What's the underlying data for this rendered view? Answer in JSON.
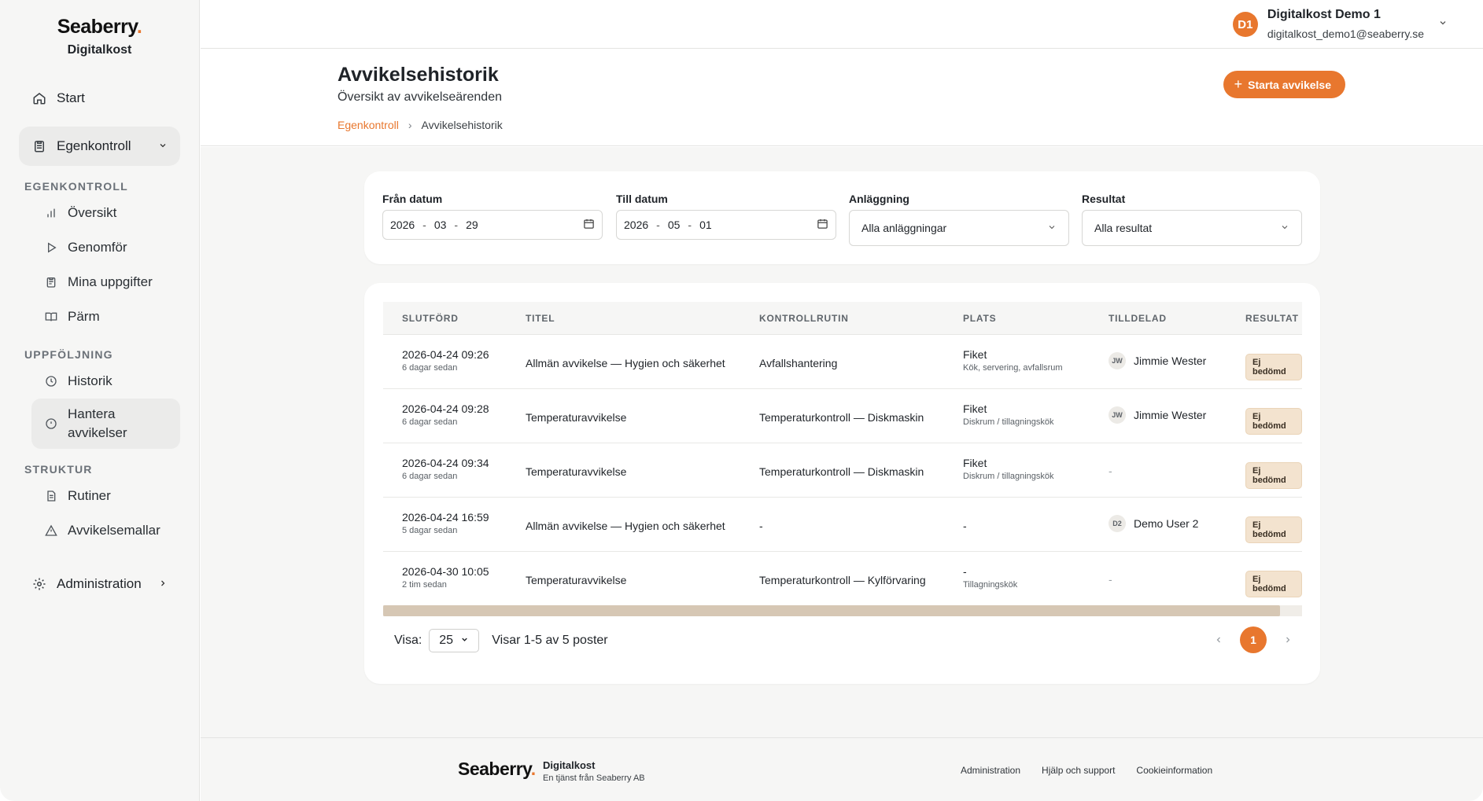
{
  "brand": {
    "logo": "Seaberry",
    "logo_dot": ".",
    "product": "Digitalkost"
  },
  "sidebar": {
    "start": "Start",
    "egenkontroll": "Egenkontroll",
    "sections": {
      "egenkontroll": "EGENKONTROLL",
      "uppfoljning": "UPPFÖLJNING",
      "struktur": "STRUKTUR"
    },
    "items": {
      "oversikt": "Översikt",
      "genomfor": "Genomför",
      "mina_uppgifter": "Mina uppgifter",
      "parm": "Pärm",
      "historik": "Historik",
      "hantera_avvikelser": "Hantera avvikelser",
      "rutiner": "Rutiner",
      "avvikelsemallar": "Avvikelsemallar"
    },
    "administration": "Administration"
  },
  "user": {
    "initials": "D1",
    "name": "Digitalkost Demo 1",
    "email": "digitalkost_demo1@seaberry.se"
  },
  "page": {
    "title": "Avvikelsehistorik",
    "subtitle": "Översikt av avvikelseärenden",
    "breadcrumb": {
      "parent": "Egenkontroll",
      "separator": "›",
      "current": "Avvikelsehistorik"
    },
    "start_button": "Starta avvikelse"
  },
  "filters": {
    "from": {
      "label": "Från datum",
      "year": "2026",
      "month": "03",
      "day": "29"
    },
    "to": {
      "label": "Till datum",
      "year": "2026",
      "month": "05",
      "day": "01"
    },
    "facility": {
      "label": "Anläggning",
      "value": "Alla anläggningar"
    },
    "result": {
      "label": "Resultat",
      "value": "Alla resultat"
    }
  },
  "table": {
    "headers": {
      "completed": "SLUTFÖRD",
      "title": "TITEL",
      "routine": "KONTROLLRUTIN",
      "place": "PLATS",
      "assigned": "TILLDELAD",
      "result": "RESULTAT"
    },
    "rows": [
      {
        "date": "2026-04-24 09:26",
        "ago": "6 dagar sedan",
        "title": "Allmän avvikelse — Hygien och säkerhet",
        "routine": "Avfallshantering",
        "place": "Fiket",
        "place_detail": "Kök, servering, avfallsrum",
        "assignee_initials": "JW",
        "assignee": "Jimmie Wester",
        "result": "Ej bedömd"
      },
      {
        "date": "2026-04-24 09:28",
        "ago": "6 dagar sedan",
        "title": "Temperaturavvikelse",
        "routine": "Temperaturkontroll — Diskmaskin",
        "place": "Fiket",
        "place_detail": "Diskrum / tillagningskök",
        "assignee_initials": "JW",
        "assignee": "Jimmie Wester",
        "result": "Ej bedömd"
      },
      {
        "date": "2026-04-24 09:34",
        "ago": "6 dagar sedan",
        "title": "Temperaturavvikelse",
        "routine": "Temperaturkontroll — Diskmaskin",
        "place": "Fiket",
        "place_detail": "Diskrum / tillagningskök",
        "assignee_initials": "",
        "assignee": "-",
        "result": "Ej bedömd"
      },
      {
        "date": "2026-04-24 16:59",
        "ago": "5 dagar sedan",
        "title": "Allmän avvikelse — Hygien och säkerhet",
        "routine": "-",
        "place": "-",
        "place_detail": "",
        "assignee_initials": "D2",
        "assignee": "Demo User 2",
        "result": "Ej bedömd"
      },
      {
        "date": "2026-04-30 10:05",
        "ago": "2 tim sedan",
        "title": "Temperaturavvikelse",
        "routine": "Temperaturkontroll — Kylförvaring",
        "place": "-",
        "place_detail": "Tillagningskök",
        "assignee_initials": "",
        "assignee": "-",
        "result": "Ej bedömd"
      }
    ]
  },
  "pagination": {
    "show_label": "Visa:",
    "page_size": "25",
    "summary": "Visar 1-5 av 5 poster",
    "current_page": "1"
  },
  "footer": {
    "logo": "Seaberry",
    "logo_dot": ".",
    "product": "Digitalkost",
    "tagline": "En tjänst från Seaberry AB",
    "links": {
      "admin": "Administration",
      "help": "Hjälp och support",
      "cookies": "Cookieinformation"
    }
  },
  "colors": {
    "accent": "#e8772e",
    "badge_bg": "#f3e3cf",
    "sidebar_bg": "#f6f6f5"
  },
  "icons": [
    "home-icon",
    "clipboard-icon",
    "bar-chart-icon",
    "play-icon",
    "clipboard-list-icon",
    "book-icon",
    "clock-icon",
    "alert-circle-icon",
    "file-icon",
    "warning-icon",
    "gear-icon",
    "chevron-down-icon",
    "chevron-right-icon",
    "calendar-icon",
    "plus-icon"
  ]
}
